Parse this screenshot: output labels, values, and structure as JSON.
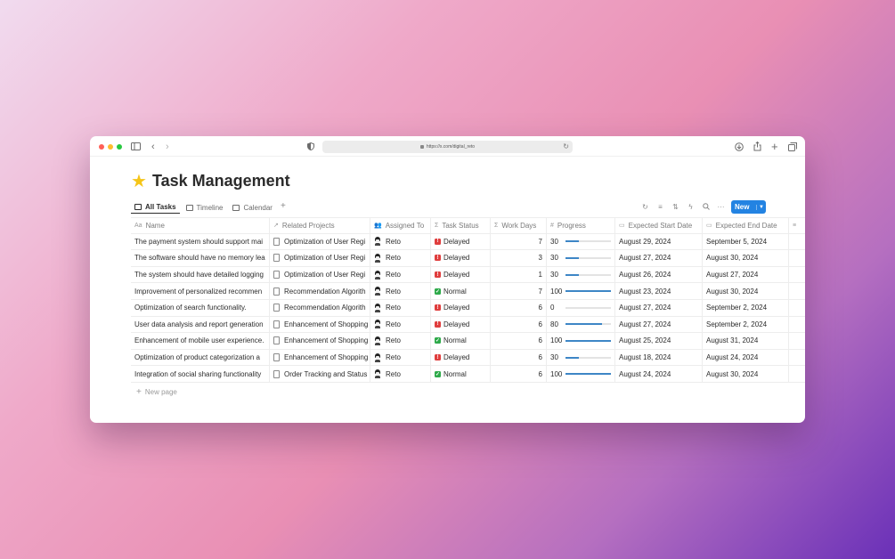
{
  "browser": {
    "url": "https://x.com/digital_reto"
  },
  "page": {
    "icon": "star-emoji",
    "title": "Task Management"
  },
  "views": [
    {
      "label": "All Tasks",
      "icon": "table-icon",
      "active": true
    },
    {
      "label": "Timeline",
      "icon": "timeline-icon",
      "active": false
    },
    {
      "label": "Calendar",
      "icon": "calendar-icon",
      "active": false
    }
  ],
  "toolbar": {
    "new_label": "New"
  },
  "columns": {
    "name": "Name",
    "projects": "Related Projects",
    "assigned": "Assigned To",
    "status": "Task Status",
    "days": "Work Days",
    "progress": "Progress",
    "start": "Expected Start Date",
    "end": "Expected End Date"
  },
  "rows": [
    {
      "name": "The payment system should support mai",
      "project": "Optimization of User Regi",
      "assigned": "Reto",
      "status": "Delayed",
      "days": "7",
      "progress": "30",
      "progress_fraction": 0.3,
      "start": "August 29, 2024",
      "end": "September 5, 2024"
    },
    {
      "name": "The software should have no memory lea",
      "project": "Optimization of User Regi",
      "assigned": "Reto",
      "status": "Delayed",
      "days": "3",
      "progress": "30",
      "progress_fraction": 0.3,
      "start": "August 27, 2024",
      "end": "August 30, 2024"
    },
    {
      "name": "The system should have detailed logging",
      "project": "Optimization of User Regi",
      "assigned": "Reto",
      "status": "Delayed",
      "days": "1",
      "progress": "30",
      "progress_fraction": 0.3,
      "start": "August 26, 2024",
      "end": "August 27, 2024"
    },
    {
      "name": "Improvement of personalized recommen",
      "project": "Recommendation Algorith",
      "assigned": "Reto",
      "status": "Normal",
      "days": "7",
      "progress": "100",
      "progress_fraction": 1.0,
      "start": "August 23, 2024",
      "end": "August 30, 2024"
    },
    {
      "name": "Optimization of search functionality.",
      "project": "Recommendation Algorith",
      "assigned": "Reto",
      "status": "Delayed",
      "days": "6",
      "progress": "0",
      "progress_fraction": 0.0,
      "start": "August 27, 2024",
      "end": "September 2, 2024"
    },
    {
      "name": "User data analysis and report generation",
      "project": "Enhancement of Shopping",
      "assigned": "Reto",
      "status": "Delayed",
      "days": "6",
      "progress": "80",
      "progress_fraction": 0.8,
      "start": "August 27, 2024",
      "end": "September 2, 2024"
    },
    {
      "name": "Enhancement of mobile user experience.",
      "project": "Enhancement of Shopping",
      "assigned": "Reto",
      "status": "Normal",
      "days": "6",
      "progress": "100",
      "progress_fraction": 1.0,
      "start": "August 25, 2024",
      "end": "August 31, 2024"
    },
    {
      "name": "Optimization of product categorization a",
      "project": "Enhancement of Shopping",
      "assigned": "Reto",
      "status": "Delayed",
      "days": "6",
      "progress": "30",
      "progress_fraction": 0.3,
      "start": "August 18, 2024",
      "end": "August 24, 2024"
    },
    {
      "name": "Integration of social sharing functionality",
      "project": "Order Tracking and Status",
      "assigned": "Reto",
      "status": "Normal",
      "days": "6",
      "progress": "100",
      "progress_fraction": 1.0,
      "start": "August 24, 2024",
      "end": "August 30, 2024"
    }
  ],
  "footer": {
    "new_page": "New page"
  },
  "colors": {
    "accent": "#2383e2",
    "delayed": "#e03e3e",
    "normal": "#2eaa4a",
    "progress": "#3d86c6"
  }
}
